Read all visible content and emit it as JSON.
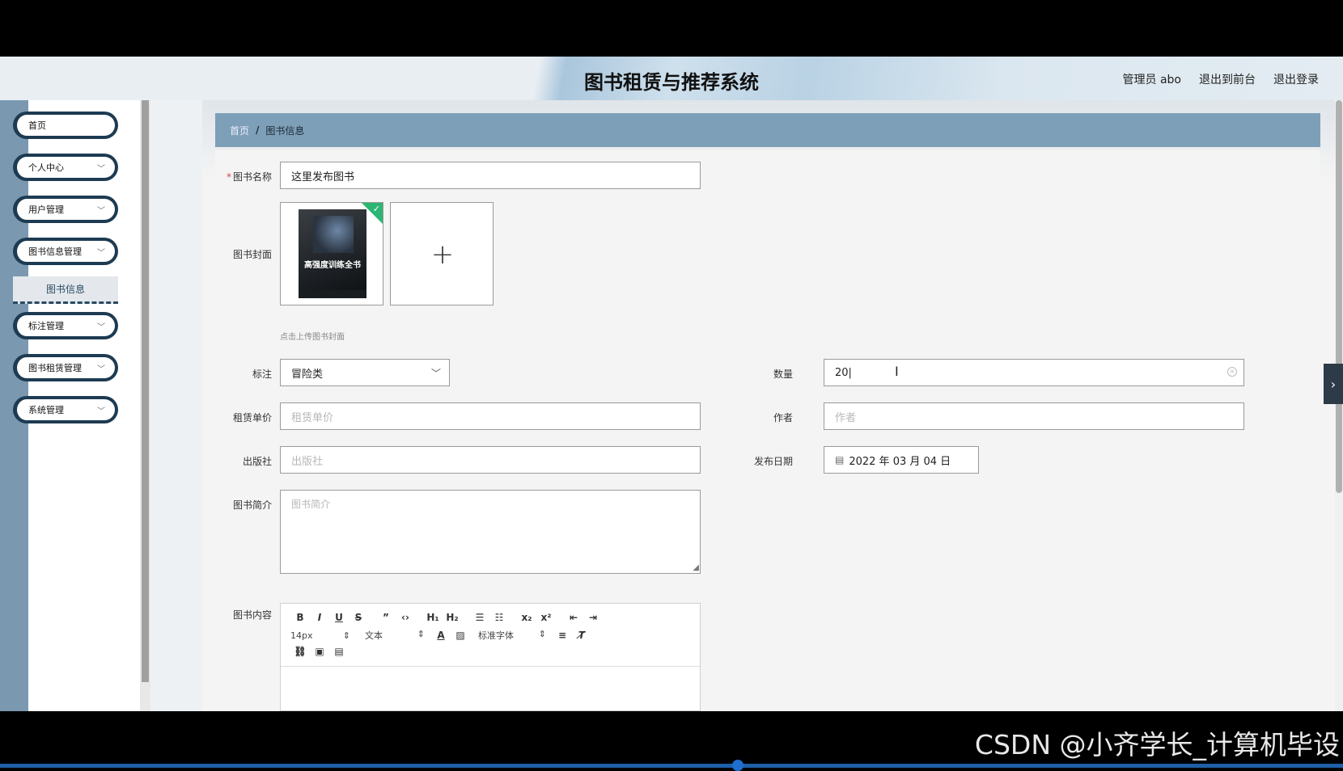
{
  "app": {
    "title": "图书租赁与推荐系统"
  },
  "header": {
    "admin": "管理员 abo",
    "exit_front": "退出到前台",
    "logout": "退出登录"
  },
  "sidebar": {
    "items": [
      {
        "label": "首页"
      },
      {
        "label": "个人中心"
      },
      {
        "label": "用户管理"
      },
      {
        "label": "图书信息管理"
      },
      {
        "label": "标注管理"
      },
      {
        "label": "图书租赁管理"
      },
      {
        "label": "系统管理"
      }
    ],
    "sub_item": "图书信息"
  },
  "breadcrumb": {
    "home": "首页",
    "sep": "/",
    "current": "图书信息"
  },
  "form": {
    "name_label": "图书名称",
    "name_value": "这里发布图书",
    "cover_label": "图书封面",
    "cover_book_title": "高强度训练全书",
    "upload_hint": "点击上传图书封面",
    "tag_label": "标注",
    "tag_value": "冒险类",
    "qty_label": "数量",
    "qty_value": "20",
    "price_label": "租赁单价",
    "price_placeholder": "租赁单价",
    "author_label": "作者",
    "author_placeholder": "作者",
    "publisher_label": "出版社",
    "publisher_placeholder": "出版社",
    "date_label": "发布日期",
    "date_value": "2022 年 03 月 04 日",
    "intro_label": "图书简介",
    "intro_placeholder": "图书简介",
    "content_label": "图书内容"
  },
  "editor": {
    "size": "14px",
    "text_type": "文本",
    "font": "标准字体"
  },
  "watermark": "CSDN @小齐学长_计算机毕设"
}
